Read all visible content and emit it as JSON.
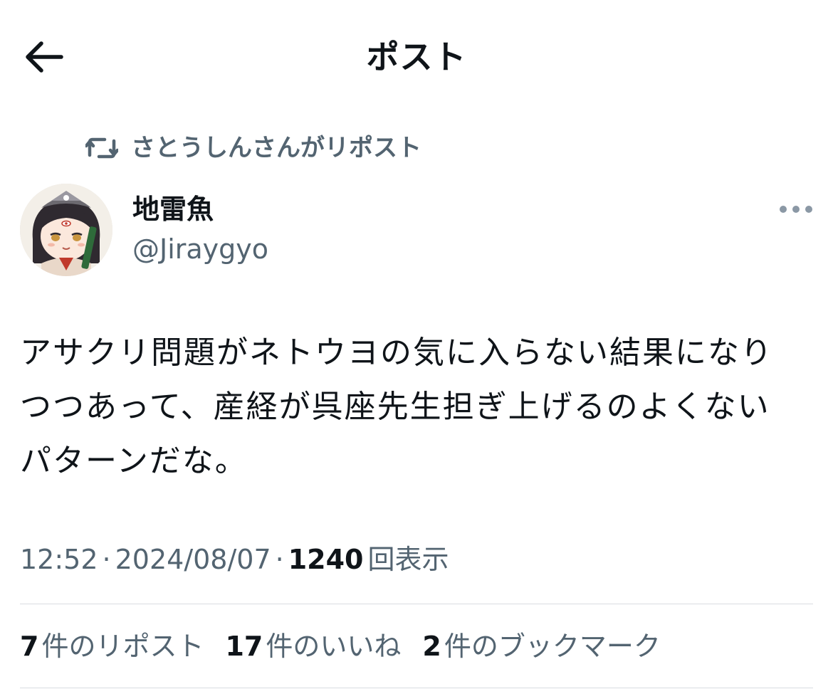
{
  "header": {
    "title": "ポスト",
    "back_icon": "arrow-left-icon"
  },
  "repost": {
    "text": "さとうしんさんがリポスト",
    "icon": "repost-icon"
  },
  "author": {
    "display_name": "地雷魚",
    "handle": "@Jiraygyo",
    "more_icon": "more-dots-icon"
  },
  "post": {
    "text": "アサクリ問題がネトウヨの気に入らない結果になり\nつつあって、産経が呉座先生担ぎ上げるのよくない\nパターンだな。"
  },
  "meta": {
    "time": "12:52",
    "date": "2024/08/07",
    "separator": "·",
    "views_count": "1240",
    "views_label": "回表示"
  },
  "stats": {
    "reposts_count": "7",
    "reposts_label": "件のリポスト",
    "likes_count": "17",
    "likes_label": "件のいいね",
    "bookmarks_count": "2",
    "bookmarks_label": "件のブックマーク"
  },
  "colors": {
    "text_primary": "#0f1419",
    "text_secondary": "#536471",
    "divider": "#d9dde1"
  }
}
